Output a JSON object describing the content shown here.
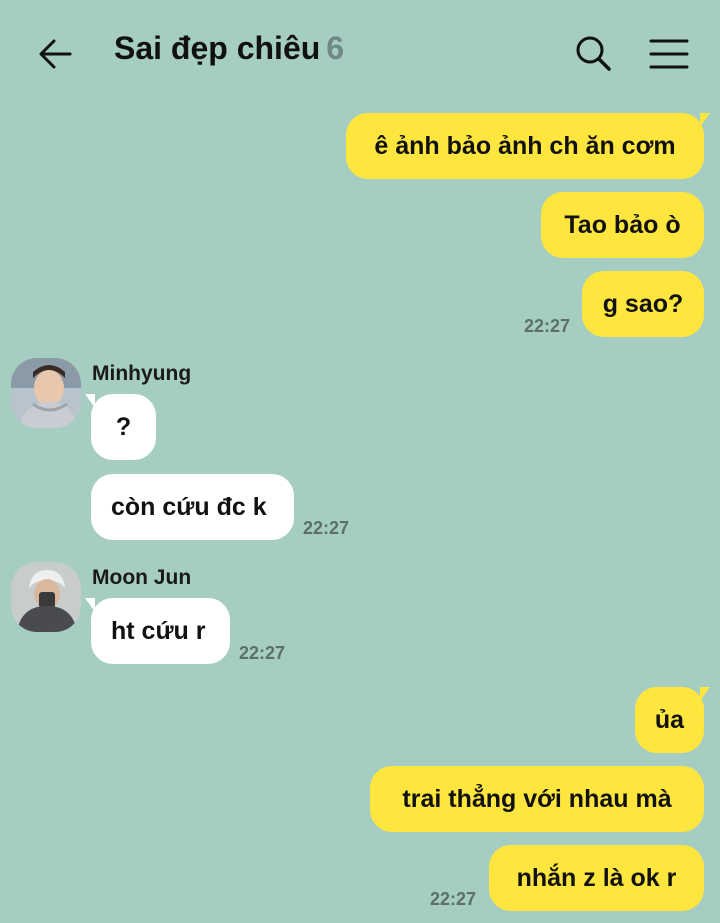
{
  "header": {
    "title": "Sai đẹp chiêu",
    "member_count": "6",
    "back_icon": "arrow-left-icon",
    "search_icon": "search-icon",
    "menu_icon": "hamburger-menu-icon"
  },
  "colors": {
    "background": "#a5cdc1",
    "my_bubble": "#fee63e",
    "other_bubble": "#ffffff"
  },
  "messages": {
    "m1": "ê ảnh bảo ảnh ch ăn cơm",
    "m2": "Tao bảo ò",
    "m3": "g sao?",
    "m3_time": "22:27",
    "minhyung_name": "Minhyung",
    "m4": "?",
    "m5": "còn cứu đc k",
    "m5_time": "22:27",
    "moonjun_name": "Moon Jun",
    "m6": "ht cứu r",
    "m6_time": "22:27",
    "m7": "ủa",
    "m8": "trai thẳng với nhau mà",
    "m9": "nhắn z là ok r",
    "m9_time": "22:27"
  }
}
